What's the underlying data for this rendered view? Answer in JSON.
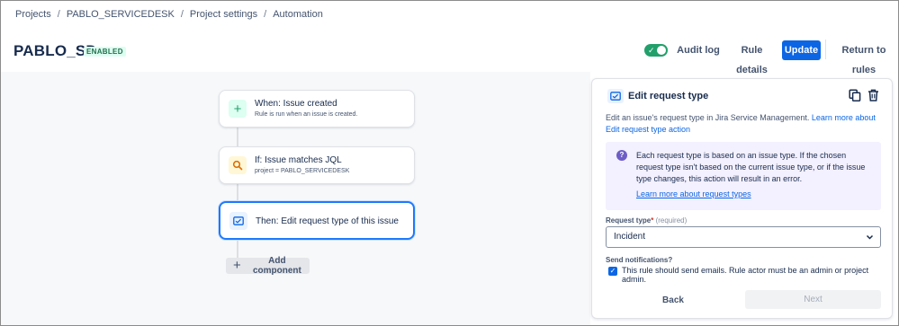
{
  "breadcrumb": {
    "items": [
      "Projects",
      "PABLO_SERVICEDESK",
      "Project settings",
      "Automation"
    ],
    "separator": "/"
  },
  "header": {
    "title": "PABLO_SD",
    "status_badge": "ENABLED",
    "toggle_on": true,
    "audit_log": "Audit log",
    "rule_details": "Rule details",
    "update": "Update",
    "return_to_rules": "Return to rules"
  },
  "canvas": {
    "nodes": [
      {
        "title": "When: Issue created",
        "subtitle": "Rule is run when an issue is created.",
        "icon": "plus-icon"
      },
      {
        "title": "If: Issue matches JQL",
        "subtitle": "project = PABLO_SERVICEDESK",
        "icon": "search-icon"
      },
      {
        "title": "Then: Edit request type of this issue",
        "icon": "request-type-icon"
      }
    ],
    "add_component": "Add component"
  },
  "panel": {
    "title": "Edit request type",
    "description_prefix": "Edit an issue's request type in Jira Service Management.",
    "description_link": "Learn more about Edit request type action",
    "info_text": "Each request type is based on an issue type. If the chosen request type isn't based on the current issue type, or if the issue type changes, this action will result in an error.",
    "info_link": "Learn more about request types",
    "request_type_label": "Request type",
    "required_marker": "*",
    "required_hint": "(required)",
    "request_type_value": "Incident",
    "send_notifications_label": "Send notifications?",
    "send_notifications_checked": true,
    "send_notifications_text": "This rule should send emails. Rule actor must be an admin or project admin.",
    "back": "Back",
    "next": "Next"
  },
  "colors": {
    "accent": "#0c66e4",
    "success": "#22a06b",
    "info_bg": "#f3f0ff",
    "selected_border": "#1d7afc"
  }
}
